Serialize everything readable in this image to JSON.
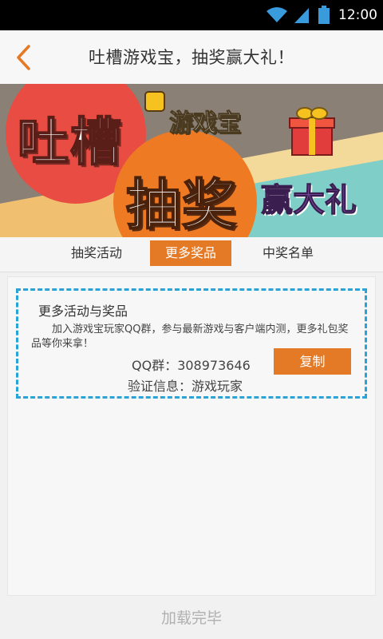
{
  "status_bar": {
    "time": "12:00",
    "icons": [
      "wifi-icon",
      "cell-signal-icon",
      "battery-icon"
    ]
  },
  "header": {
    "back_icon": "chevron-left-icon",
    "title": "吐槽游戏宝，抽奖赢大礼！"
  },
  "banner": {
    "word_tucao": "吐槽",
    "word_app": "游戏宝",
    "word_lottery": "抽奖",
    "word_prize": "赢大礼",
    "gift_icon": "gift-box-icon",
    "logo_icon": "rabbit-logo-icon"
  },
  "tabs": [
    {
      "label": "抽奖活动",
      "active": false
    },
    {
      "label": "更多奖品",
      "active": true
    },
    {
      "label": "中奖名单",
      "active": false
    }
  ],
  "content": {
    "heading": "更多活动与奖品",
    "description": "加入游戏宝玩家QQ群，参与最新游戏与客户端内测，更多礼包奖品等你来拿！",
    "qq_group": "QQ群：308973646",
    "verify_info": "验证信息：游戏玩家",
    "copy_label": "复制"
  },
  "footer": {
    "load_status": "加载完毕"
  },
  "colors": {
    "accent": "#e57a26",
    "dashed_border": "#2aa3d6",
    "banner_red": "#e84c42",
    "banner_orange": "#ee7b24",
    "banner_purple": "#7b4aa0"
  }
}
